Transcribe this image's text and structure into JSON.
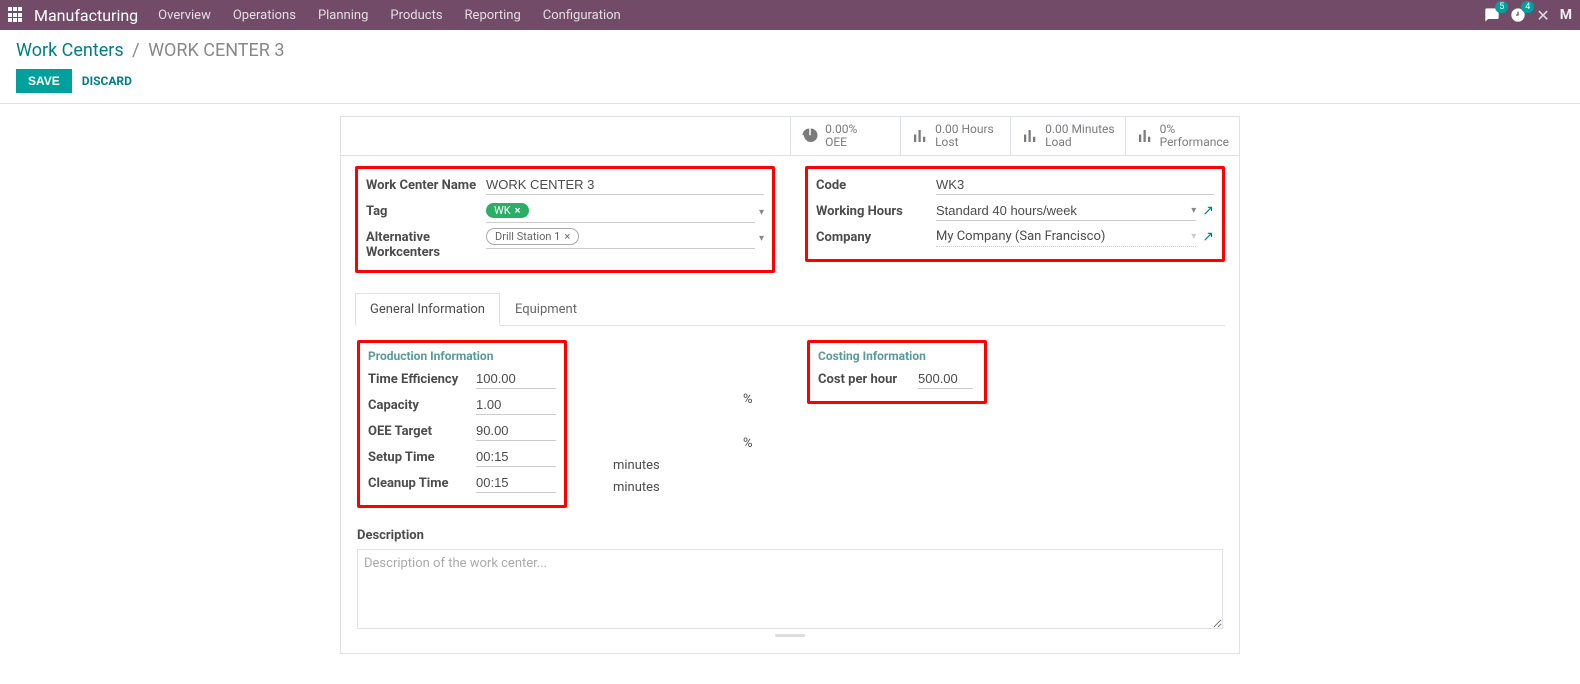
{
  "navbar": {
    "app_name": "Manufacturing",
    "menu": [
      "Overview",
      "Operations",
      "Planning",
      "Products",
      "Reporting",
      "Configuration"
    ],
    "chat_badge": "5",
    "activity_badge": "4",
    "avatar_letter": "M"
  },
  "breadcrumb": {
    "parent": "Work Centers",
    "sep": "/",
    "current": "WORK CENTER 3"
  },
  "buttons": {
    "save": "SAVE",
    "discard": "DISCARD"
  },
  "stats": {
    "oee": {
      "value": "0.00%",
      "label": "OEE"
    },
    "lost": {
      "value": "0.00 Hours",
      "label": "Lost"
    },
    "load": {
      "value": "0.00 Minutes",
      "label": "Load"
    },
    "performance": {
      "value": "0%",
      "label": "Performance"
    }
  },
  "fields_left": {
    "name_label": "Work Center Name",
    "name_value": "WORK CENTER 3",
    "tag_label": "Tag",
    "tag_value": "WK",
    "alt_label": "Alternative Workcenters",
    "alt_value": "Drill Station 1"
  },
  "fields_right": {
    "code_label": "Code",
    "code_value": "WK3",
    "hours_label": "Working Hours",
    "hours_value": "Standard 40 hours/week",
    "company_label": "Company",
    "company_value": "My Company (San Francisco)"
  },
  "tabs": {
    "general": "General Information",
    "equipment": "Equipment"
  },
  "production": {
    "section": "Production Information",
    "time_eff_label": "Time Efficiency",
    "time_eff_value": "100.00",
    "pct": "%",
    "capacity_label": "Capacity",
    "capacity_value": "1.00",
    "oee_target_label": "OEE Target",
    "oee_target_value": "90.00",
    "setup_label": "Setup Time",
    "setup_value": "00:15",
    "cleanup_label": "Cleanup Time",
    "cleanup_value": "00:15",
    "minutes": "minutes"
  },
  "costing": {
    "section": "Costing Information",
    "cph_label": "Cost per hour",
    "cph_value": "500.00"
  },
  "description": {
    "label": "Description",
    "placeholder": "Description of the work center..."
  }
}
